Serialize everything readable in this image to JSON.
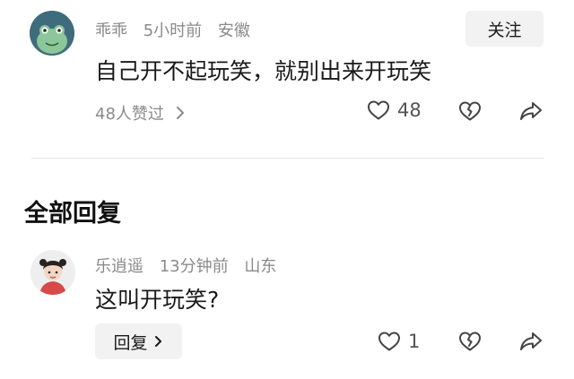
{
  "comment": {
    "username": "乖乖",
    "time": "5小时前",
    "location": "安徽",
    "follow_label": "关注",
    "text": "自己开不起玩笑，就别出来开玩笑",
    "likers": "48人赞过",
    "like_count": "48"
  },
  "replies_section": {
    "title": "全部回复"
  },
  "reply": {
    "username": "乐逍遥",
    "time": "13分钟前",
    "location": "山东",
    "text": "这叫开玩笑?",
    "reply_label": "回复",
    "like_count": "1"
  },
  "colors": {
    "avatar1_bg": "#3f6c7c",
    "avatar1_figure": "#7fbf8a",
    "text_primary": "#1a1a1a",
    "text_secondary": "#8a8a8a",
    "button_bg": "#f2f2f2"
  }
}
